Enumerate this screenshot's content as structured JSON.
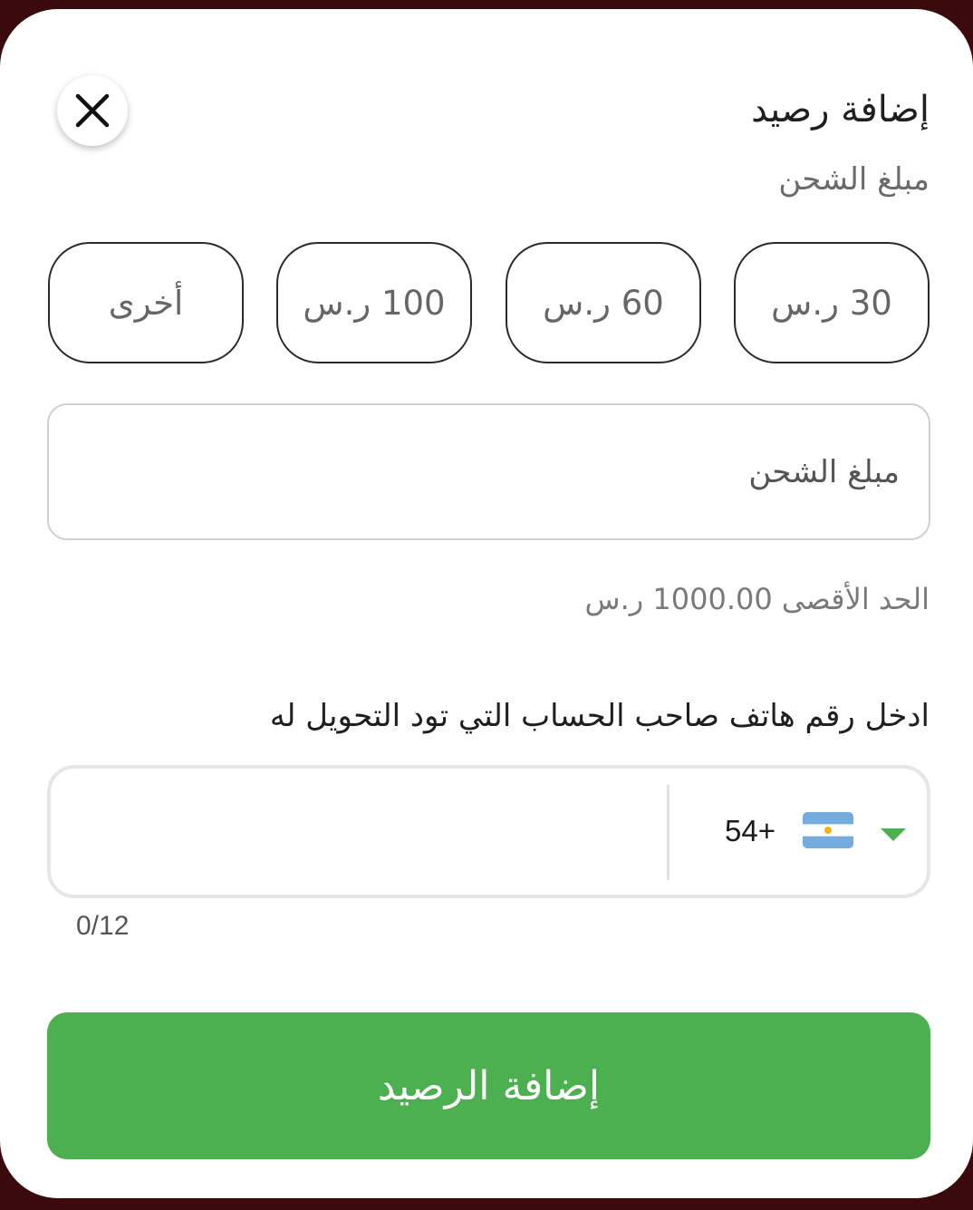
{
  "sheet": {
    "title": "إضافة رصيد",
    "subtitle": "مبلغ الشحن"
  },
  "amount_options": [
    {
      "label": "30 ر.س"
    },
    {
      "label": "60 ر.س"
    },
    {
      "label": "100 ر.س"
    },
    {
      "label": "أخرى"
    }
  ],
  "amount_field": {
    "placeholder": "مبلغ الشحن",
    "value": ""
  },
  "max_amount_text": "الحد الأقصى 1000.00 ر.س",
  "phone": {
    "label": "ادخل رقم هاتف صاحب الحساب التي تود التحويل له",
    "dial_code": "54+",
    "country_flag": "argentina-flag-icon",
    "value": "",
    "counter": "0/12"
  },
  "submit_label": "إضافة الرصيد",
  "colors": {
    "accent": "#4caf50",
    "text": "#1f1f1f",
    "muted": "#6b6b6b"
  }
}
